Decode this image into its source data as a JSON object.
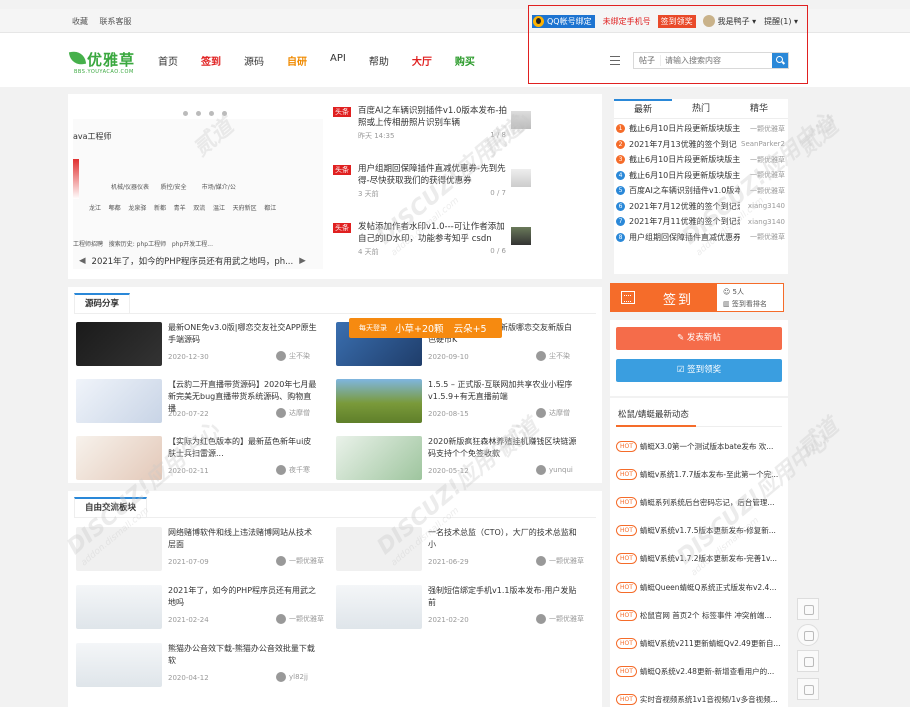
{
  "topbar": {
    "left_links": [
      "收藏",
      "联系客服"
    ],
    "qq_bind": "QQ帐号绑定",
    "phone_bind": "未绑定手机号",
    "sign_label": "签到领奖",
    "username": "我是鸭子",
    "remind": "提醒(1)"
  },
  "header": {
    "logo_text": "优雅草",
    "logo_sub": "BBS.YOUYACAO.COM",
    "nav": [
      "首页",
      "签到",
      "源码",
      "自研",
      "API",
      "帮助",
      "大厅",
      "购买"
    ],
    "search_type": "帖子",
    "search_placeholder": "请输入搜索内容"
  },
  "slider": {
    "caption": "2021年了，如今的PHP程序员还有用武之地吗，ph...",
    "java_text": "ava工程师",
    "row1": [
      "机械/仪器仪表",
      "质控/安全",
      "市场/媒介/公"
    ],
    "row2": [
      "龙江",
      "郫都",
      "龙泉驿",
      "新都",
      "青羊",
      "双流",
      "温江",
      "天府新区",
      "都江"
    ],
    "row3": [
      "工程师招聘",
      "搜索历史: php工程师",
      "php开发工程..."
    ]
  },
  "headlines": [
    {
      "tag": "头条",
      "title": "百度AI之车辆识别插件v1.0版本发布-拍照或上传相册照片识别车辆",
      "time": "昨天 14:35",
      "count": "1 / 8"
    },
    {
      "tag": "头条",
      "title": "用户组期回保障插件直减优惠券-先到先得-尽快获取我们的获得优惠券",
      "time": "3 天前",
      "count": "0 / 7"
    },
    {
      "tag": "头条",
      "title": "发帖添加作者水印v1.0---可让作者添加自己的ID水印，功能参考知乎 csdn",
      "time": "4 天前",
      "count": "0 / 6"
    }
  ],
  "tabs": {
    "labels": [
      "最新",
      "热门",
      "精华"
    ],
    "items": [
      {
        "n": "1",
        "title": "截止6月10日片段更新版块版主",
        "author": "一颗优雅草",
        "color": "#f56c2a"
      },
      {
        "n": "2",
        "title": "2021年7月13优雅的签个到记",
        "author": "SeanParker2",
        "color": "#f56c2a"
      },
      {
        "n": "3",
        "title": "截止6月10日片段更新版块版主",
        "author": "一颗优雅草",
        "color": "#f56c2a"
      },
      {
        "n": "4",
        "title": "截止6月10日片段更新版块版主",
        "author": "一颗优雅草",
        "color": "#2a88d8"
      },
      {
        "n": "5",
        "title": "百度AI之车辆识别插件v1.0版本",
        "author": "一颗优雅草",
        "color": "#2a88d8"
      },
      {
        "n": "6",
        "title": "2021年7月12优雅的签个到记录",
        "author": "xiang3140",
        "color": "#2a88d8"
      },
      {
        "n": "7",
        "title": "2021年7月11优雅的签个到记录",
        "author": "xiang3140",
        "color": "#2a88d8"
      },
      {
        "n": "8",
        "title": "用户组期回保障插件直减优惠券",
        "author": "一颗优雅草",
        "color": "#2a88d8"
      }
    ]
  },
  "sign": {
    "label": "签到",
    "count": "5人",
    "rank": "签到看排名"
  },
  "actions": {
    "post": "发表新帖",
    "sign": "签到领奖"
  },
  "hot": {
    "title": "松鼠/蜻蜓最新动态",
    "badge": "HOT",
    "items": [
      "蜻蜓X3.0第一个测试版本bate发布 欢...",
      "蜻蜓v系统1.7.7版本发布-至此第一个完...",
      "蜻蜓系列系统后台密码忘记，后台管理...",
      "蜻蜓V系统v1.7.5版本更新发布-修复新...",
      "蜻蜓V系统v1.7.2版本更新发布-完善1v...",
      "蜻蜓Queen蜻蜓Q系统正式版发布v2.4...",
      "松鼠官网 首页2个 标签事件 冲突前端...",
      "蜻蜓V系统v211更新蜻蜓Qv2.49更新自...",
      "蜻蜓Q系统v2.48更新-新增查看用户的...",
      "实时音视频系统1v1音视频/1v多音视频..."
    ]
  },
  "code": {
    "title": "源码分享",
    "cards": [
      {
        "title": "最新ONE免v3.0版|哪恋交友社交APP原生手端源码",
        "date": "2020-12-30",
        "user": "尘不染"
      },
      {
        "title": "美颜新版白色硬币最新版哪恋交友新版白色硬币K",
        "date": "2020-09-10",
        "user": "尘不染"
      },
      {
        "title": "【云豹二开直播带货源码】2020年七月最新完美无bug直播带货系统源码、购物直播",
        "date": "2020-07-22",
        "user": "达摩僧"
      },
      {
        "title": "1.5.5 – 正式版-互联网加共享农业小程序v1.5.9+有无直播前端",
        "date": "2020-08-15",
        "user": "达摩僧"
      },
      {
        "title": "【实际为红色版本的】最新蓝色新年ui皮肤士兵扫雷源...",
        "date": "2020-02-11",
        "user": "夜千寒"
      },
      {
        "title": "2020新版疯狂森林养殖挂机赚钱区块链源码支持个个免签收款",
        "date": "2020-05-12",
        "user": "yunqui"
      }
    ]
  },
  "popup": {
    "left": "每天登录",
    "points": "小草+20颗",
    "coins": "云朵+5"
  },
  "forum": {
    "title": "自由交流板块",
    "cards": [
      {
        "title": "网络赌博软件和线上违法赌博网站从技术层面",
        "date": "2021-07-09",
        "user": "一颗优雅草"
      },
      {
        "title": "一名技术总监（CTO），大厂的技术总监和小",
        "date": "2021-06-29",
        "user": "一颗优雅草"
      },
      {
        "title": "2021年了，如今的PHP程序员还有用武之地吗",
        "date": "2021-02-24",
        "user": "一颗优雅草"
      },
      {
        "title": "强制短信绑定手机v1.1版本发布-用户发贴前",
        "date": "2021-02-20",
        "user": "一颗优雅草"
      },
      {
        "title": "熊猫办公音效下载-熊猫办公音效批量下载软",
        "date": "2020-04-12",
        "user": "yl82jj"
      }
    ]
  },
  "watermark": {
    "main": "DISCUZ!应用中心",
    "sub": "addon.dismall.com",
    "mark": "贰道"
  }
}
